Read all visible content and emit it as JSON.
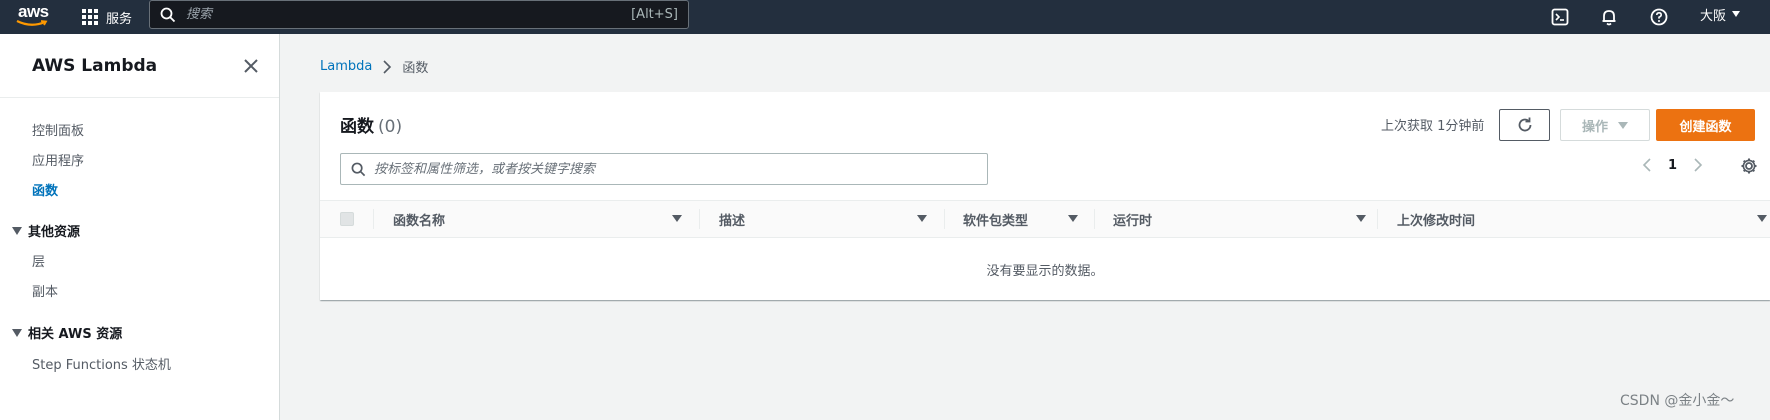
{
  "topnav": {
    "logo_text": "aws",
    "services_label": "服务",
    "search_placeholder": "搜索",
    "search_shortcut": "[Alt+S]",
    "region_label": "大阪"
  },
  "sidebar": {
    "title": "AWS Lambda",
    "items": [
      {
        "label": "控制面板"
      },
      {
        "label": "应用程序"
      },
      {
        "label": "函数"
      }
    ],
    "sections": [
      {
        "title": "其他资源",
        "items": [
          {
            "label": "层"
          },
          {
            "label": "副本"
          }
        ]
      },
      {
        "title": "相关 AWS 资源",
        "items": [
          {
            "label": "Step Functions 状态机"
          }
        ]
      }
    ]
  },
  "breadcrumb": {
    "root": "Lambda",
    "current": "函数"
  },
  "panel": {
    "title": "函数",
    "count": "(0)",
    "last_fetch": "上次获取 1分钟前",
    "actions_label": "操作",
    "create_label": "创建函数",
    "filter_placeholder": "按标签和属性筛选，或者按关键字搜索",
    "page_number": "1",
    "columns": [
      "函数名称",
      "描述",
      "软件包类型",
      "运行时",
      "上次修改时间"
    ],
    "empty_message": "没有要显示的数据。"
  },
  "watermark": "CSDN @金小金～",
  "colors": {
    "nav_bg": "#232f3e",
    "primary_button": "#ec7211",
    "link": "#0073bb",
    "page_bg": "#f2f3f3"
  }
}
